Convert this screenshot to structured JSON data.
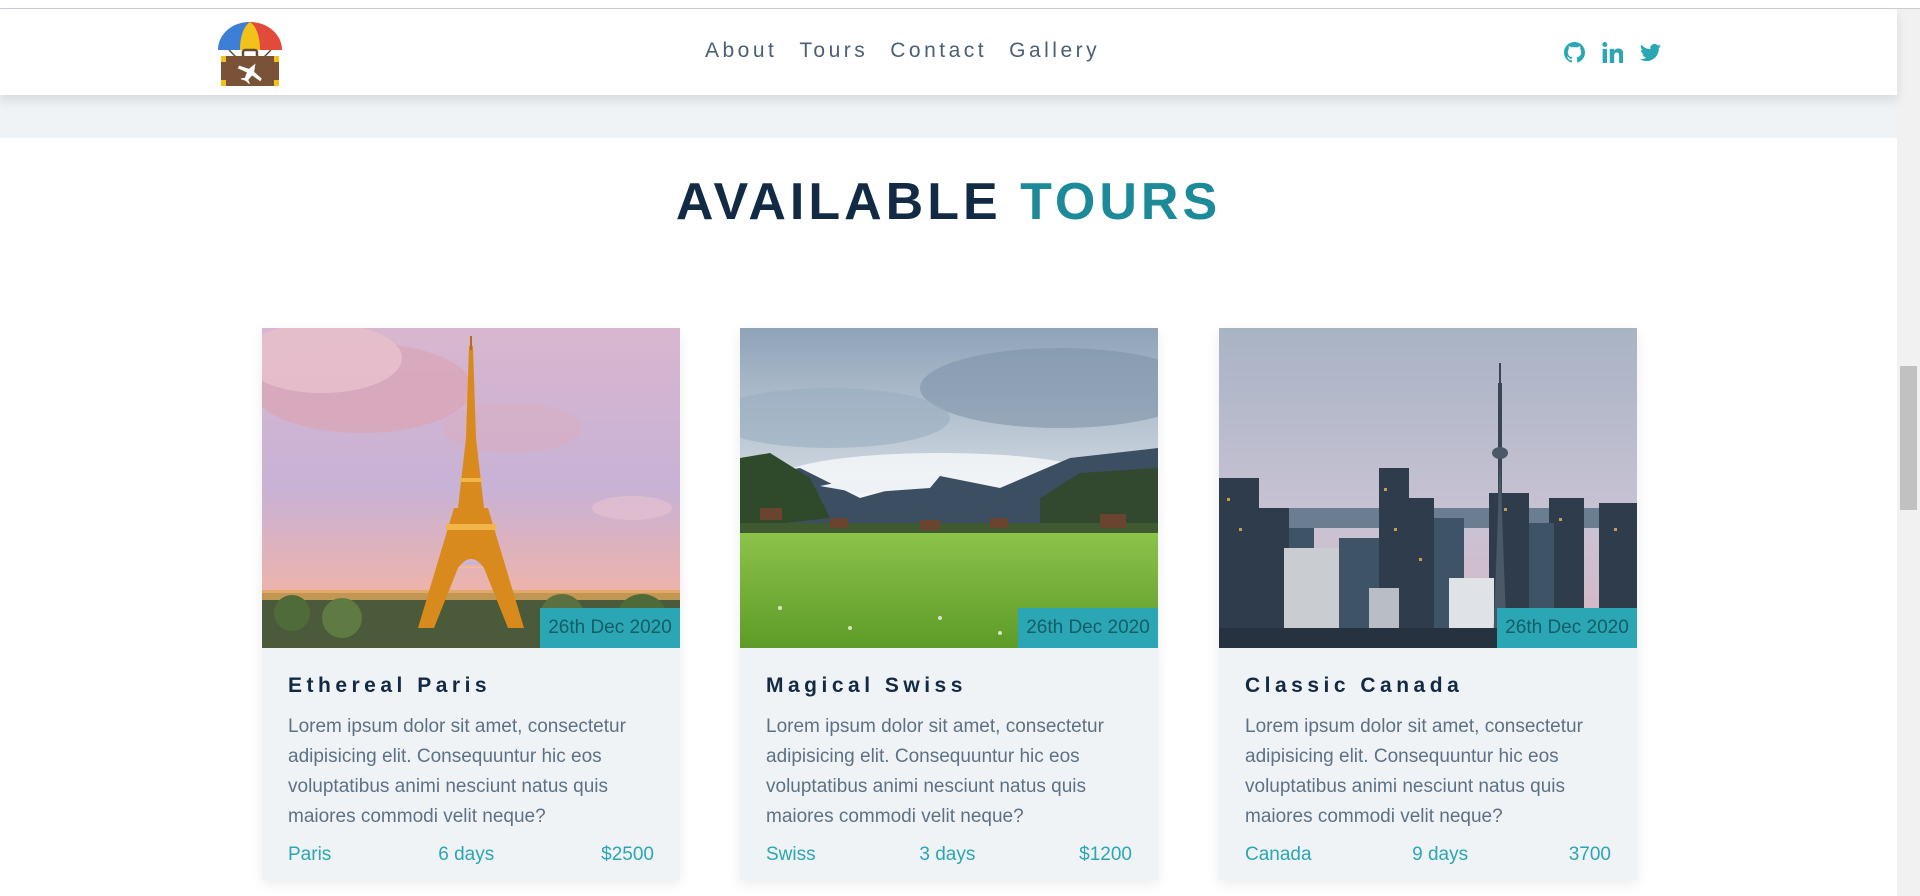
{
  "nav": {
    "links": [
      "About",
      "Tours",
      "Contact",
      "Gallery"
    ],
    "socials": [
      "github-icon",
      "linkedin-icon",
      "twitter-icon"
    ]
  },
  "section": {
    "title_main": "AVAILABLE",
    "title_accent": "TOURS"
  },
  "tours": [
    {
      "name": "Ethereal Paris",
      "date": "26th Dec 2020",
      "description": "Lorem ipsum dolor sit amet, consectetur adipisicing elit. Consequuntur hic eos voluptatibus animi nesciunt natus quis maiores commodi velit neque?",
      "location": "Paris",
      "duration": "6 days",
      "price": "$2500"
    },
    {
      "name": "Magical Swiss",
      "date": "26th Dec 2020",
      "description": "Lorem ipsum dolor sit amet, consectetur adipisicing elit. Consequuntur hic eos voluptatibus animi nesciunt natus quis maiores commodi velit neque?",
      "location": "Swiss",
      "duration": "3 days",
      "price": "$1200"
    },
    {
      "name": "Classic Canada",
      "date": "26th Dec 2020",
      "description": "Lorem ipsum dolor sit amet, consectetur adipisicing elit. Consequuntur hic eos voluptatibus animi nesciunt natus quis maiores commodi velit neque?",
      "location": "Canada",
      "duration": "9 days",
      "price": "3700"
    }
  ],
  "colors": {
    "accent": "#2ba6b4",
    "title_dark": "#122a44",
    "title_accent": "#1c8a99",
    "band": "#f0f3f6"
  }
}
